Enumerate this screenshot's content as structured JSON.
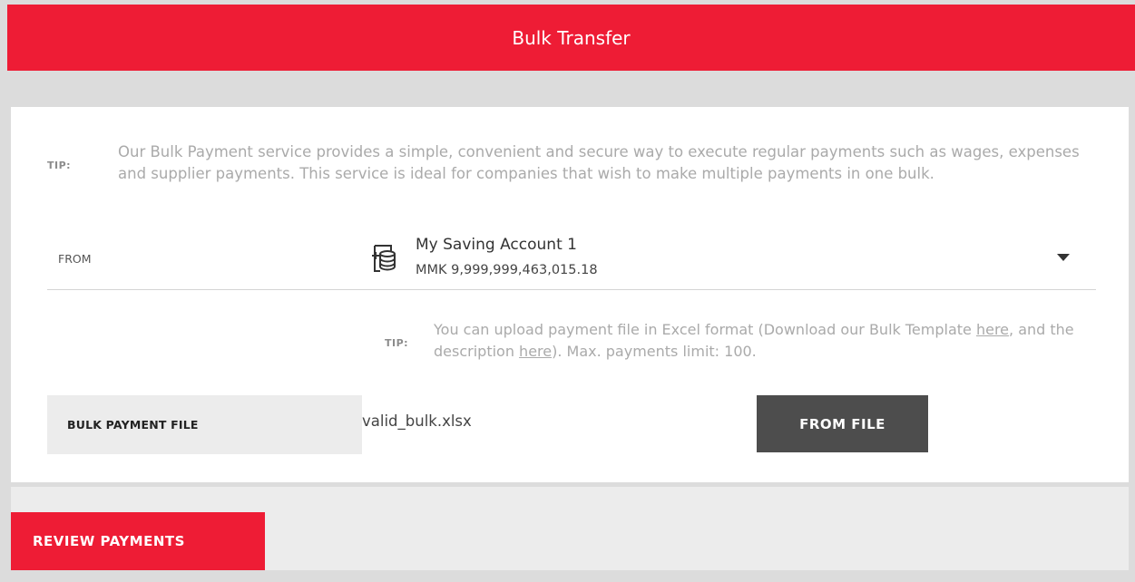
{
  "header": {
    "title": "Bulk Transfer"
  },
  "tip_intro": {
    "label": "TIP:",
    "text": "Our Bulk Payment service provides a simple, convenient and secure way to execute regular payments such as wages, expenses and supplier payments. This service is ideal for companies that wish to make multiple payments in one bulk."
  },
  "from": {
    "label": "FROM",
    "account_name": "My Saving Account 1",
    "account_balance": "MMK 9,999,999,463,015.18",
    "account_icon": "database-add-icon",
    "dropdown_icon": "caret-down-icon"
  },
  "tip_upload": {
    "label": "TIP:",
    "text_part1": "You can upload payment file in Excel format (Download our Bulk Template ",
    "link1": "here",
    "text_part2": ", and the description ",
    "link2": "here",
    "text_part3": "). Max. payments limit: 100."
  },
  "bulk_file": {
    "label": "BULK PAYMENT FILE",
    "file_name": "valid_bulk.xlsx",
    "button_label": "FROM FILE"
  },
  "footer": {
    "review_label": "REVIEW PAYMENTS"
  },
  "colors": {
    "brand": "#ee1c35",
    "dark_button": "#4d4d4d",
    "page_bg": "#dcdcdc"
  }
}
